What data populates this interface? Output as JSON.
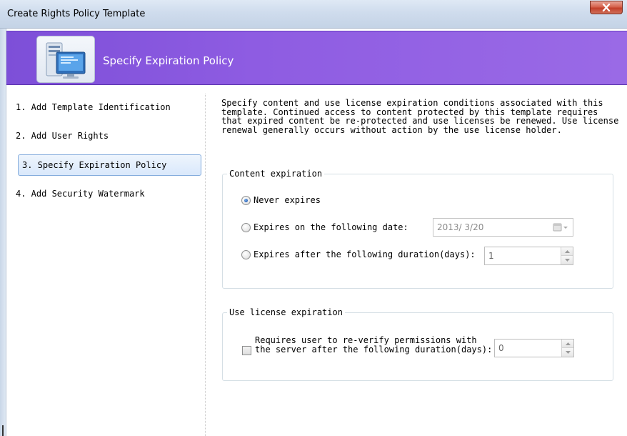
{
  "window": {
    "title": "Create Rights Policy Template",
    "close_icon": "close-icon"
  },
  "banner": {
    "title": "Specify Expiration Policy",
    "icon": "server-monitor-icon",
    "gradient": [
      "#7d4fd8",
      "#9a6ae6"
    ]
  },
  "nav": {
    "items": [
      {
        "label": "1. Add Template Identification",
        "selected": false
      },
      {
        "label": "2. Add User Rights",
        "selected": false
      },
      {
        "label": "3. Specify Expiration Policy",
        "selected": true
      },
      {
        "label": "4. Add Security Watermark",
        "selected": false
      }
    ]
  },
  "description": "Specify content and use license expiration conditions associated with this template. Continued access to content protected by this template requires that expired content be re-protected and use licenses be renewed. Use license renewal generally occurs without action by the use license holder.",
  "content_expiration": {
    "legend": "Content expiration",
    "options": [
      {
        "label": "Never expires",
        "checked": true
      },
      {
        "label": "Expires on the following date:",
        "checked": false
      },
      {
        "label": "Expires after the following duration(days):",
        "checked": false
      }
    ],
    "date_value": "2013/ 3/20",
    "calendar_icon": "calendar-dropdown-icon",
    "duration_value": "1"
  },
  "use_license_expiration": {
    "legend": "Use license expiration",
    "checkbox_label": "Requires user to re-verify permissions with the server after the following duration(days):",
    "checked": false,
    "duration_value": "0"
  },
  "colors": {
    "accent": "#8e5ce2",
    "selected_border": "#84acdd",
    "group_border": "#d5dfe5"
  }
}
